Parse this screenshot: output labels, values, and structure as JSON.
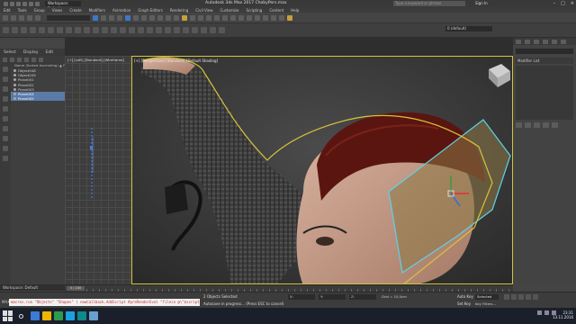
{
  "titlebar": {
    "workspace": "Workspace: Default",
    "app_title": "Autodesk 3ds Max 2017    ChobyPers.max",
    "search_placeholder": "Type a keyword or phrase",
    "signin": "Sign In",
    "window_buttons": [
      "–",
      "□",
      "×"
    ]
  },
  "menu": [
    "Edit",
    "Tools",
    "Group",
    "Views",
    "Create",
    "Modifiers",
    "Animation",
    "Graph Editors",
    "Rendering",
    "Civil View",
    "Customize",
    "Scripting",
    "Content",
    "Help"
  ],
  "ribbon": {
    "layer_dropdown": "0 (default)"
  },
  "scene_explorer": {
    "tabs": [
      "Select",
      "Display",
      "Edit"
    ],
    "column_header": "Name (Sorted Ascending)    ▲ Frozen",
    "rows": [
      {
        "label": "Object048",
        "selected": false
      },
      {
        "label": "Object049",
        "selected": false
      },
      {
        "label": "Plane001",
        "selected": false
      },
      {
        "label": "Plane002",
        "selected": false
      },
      {
        "label": "Plane003",
        "selected": false
      },
      {
        "label": "Plane004",
        "selected": true
      },
      {
        "label": "Plane005",
        "selected": true
      }
    ],
    "workspace_bar": "Workspace: Default"
  },
  "viewports": {
    "left_label": "[+] [Left] [Standard] [Wireframe]",
    "main_label": "[+] [Perspective] [Standard] [Default Shading]"
  },
  "command_panel": {
    "modifier_list": "Modifier List"
  },
  "timeline": {
    "frame": "0 / 100"
  },
  "status": {
    "maxscript_label": "MAXScript",
    "maxscript_text": "macros.run \"Objects\" \"Shapes\"  ( newCallback.AddScript #preRenderEval \"filein @\\\"$scripts\\\\...",
    "line1": "2 Objects Selected",
    "line2": "Autosave in progress... (Press ESC to cancel)",
    "x": "X:",
    "y": "Y:",
    "z": "Z:",
    "grid": "Grid = 10,0cm",
    "auto_key": "Auto Key",
    "selected": "Selected",
    "set_key": "Set Key",
    "key_filters": "Key Filters..."
  },
  "taskbar": {
    "time": "23:31",
    "date": "13.11.2016",
    "app_colors": [
      "#3a7bd5",
      "#f0b400",
      "#2d9b4e",
      "#1ba1e2",
      "#0d8a8a",
      "#6aa0d0"
    ]
  }
}
